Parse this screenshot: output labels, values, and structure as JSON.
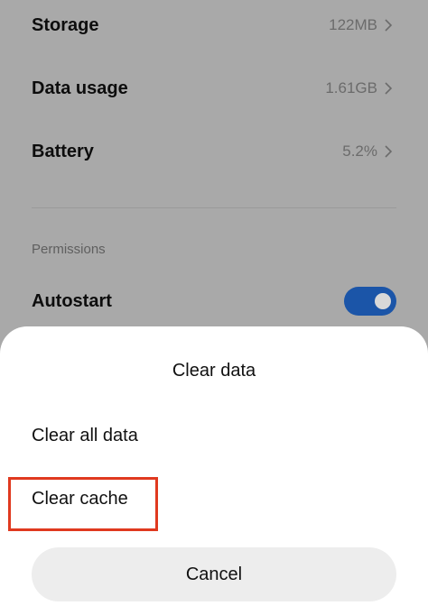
{
  "settings": {
    "rows": [
      {
        "label": "Storage",
        "value": "122MB"
      },
      {
        "label": "Data usage",
        "value": "1.61GB"
      },
      {
        "label": "Battery",
        "value": "5.2%"
      }
    ],
    "permissions_header": "Permissions",
    "autostart": {
      "label": "Autostart",
      "enabled": true
    }
  },
  "dialog": {
    "title": "Clear data",
    "options": [
      "Clear all data",
      "Clear cache"
    ],
    "cancel_label": "Cancel"
  },
  "colors": {
    "toggle_on": "#1b55a8",
    "highlight": "#e0391f",
    "dimmed_background": "#a9a9a9"
  }
}
